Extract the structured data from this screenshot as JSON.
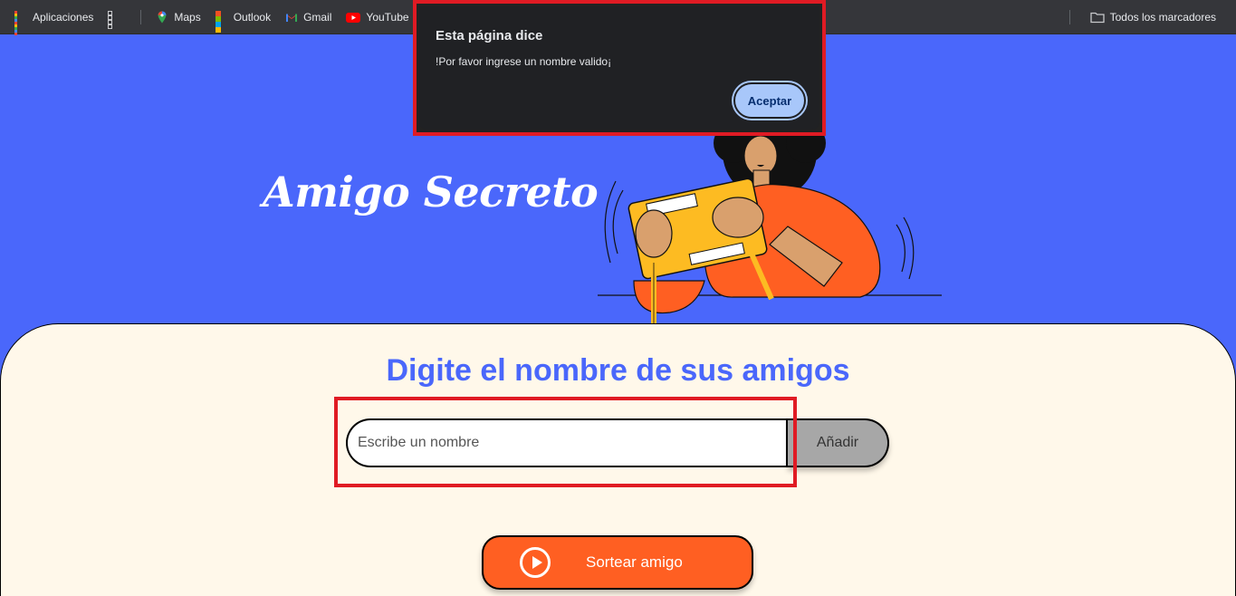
{
  "bookmarks_bar": {
    "items": [
      {
        "label": "Aplicaciones",
        "icon": "apps-icon"
      },
      {
        "label": "",
        "icon": "grid-icon"
      },
      {
        "label": "Maps",
        "icon": "maps-icon"
      },
      {
        "label": "Outlook",
        "icon": "microsoft-icon"
      },
      {
        "label": "Gmail",
        "icon": "gmail-icon"
      },
      {
        "label": "YouTube",
        "icon": "youtube-icon"
      }
    ],
    "all_bookmarks_label": "Todos los marcadores",
    "all_bookmarks_icon": "folder-icon"
  },
  "header": {
    "title": "Amigo Secreto",
    "illustration": "person-holding-gift-illustration"
  },
  "main": {
    "subtitle": "Digite el nombre de sus amigos",
    "input_placeholder": "Escribe un nombre",
    "input_value": "",
    "add_button_label": "Añadir",
    "draw_button_label": "Sortear amigo",
    "draw_button_icon": "play-icon"
  },
  "alert": {
    "title": "Esta página dice",
    "message": "!Por favor ingrese un nombre valido¡",
    "accept_label": "Aceptar"
  },
  "colors": {
    "primary_blue": "#4a67fb",
    "panel_bg": "#fff8ea",
    "accent_orange": "#ff5f22",
    "highlight_red": "#e01b24",
    "button_gray": "#a7a7a7"
  }
}
